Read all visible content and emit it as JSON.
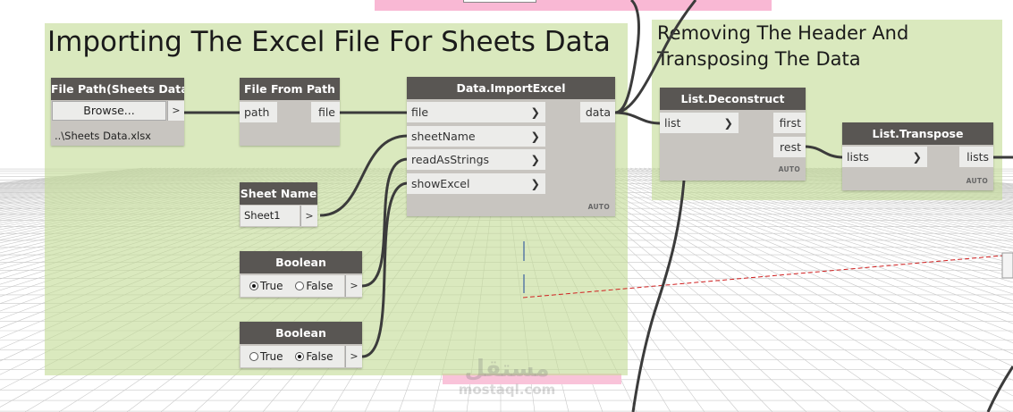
{
  "groups": {
    "import": {
      "title": "Importing The Excel File For Sheets Data"
    },
    "transpose": {
      "title_line1": "Removing The Header And",
      "title_line2": "Transposing The Data"
    }
  },
  "nodes": {
    "file_path": {
      "title": "File Path(Sheets Data)",
      "browse_label": "Browse...",
      "output_chevron": ">",
      "path_value": "..\\Sheets Data.xlsx"
    },
    "file_from_path": {
      "title": "File From Path",
      "input": "path",
      "output": "file"
    },
    "import_excel": {
      "title": "Data.ImportExcel",
      "inputs": [
        "file",
        "sheetName",
        "readAsStrings",
        "showExcel"
      ],
      "output": "data",
      "lacing": "AUTO"
    },
    "sheet_name": {
      "title": "Sheet Name",
      "value": "Sheet1",
      "output_chevron": ">"
    },
    "boolean_1": {
      "title": "Boolean",
      "true_label": "True",
      "false_label": "False",
      "selected": "True",
      "output_chevron": ">"
    },
    "boolean_2": {
      "title": "Boolean",
      "true_label": "True",
      "false_label": "False",
      "selected": "False",
      "output_chevron": ">"
    },
    "list_deconstruct": {
      "title": "List.Deconstruct",
      "input": "list",
      "outputs": [
        "first",
        "rest"
      ],
      "lacing": "AUTO"
    },
    "list_transpose": {
      "title": "List.Transpose",
      "input": "lists",
      "output": "lists",
      "lacing": "AUTO"
    }
  },
  "watermark": {
    "line1": "مستقل",
    "line2": "mostaql.com"
  },
  "colors": {
    "group_fill": "#c4dc96",
    "node_header": "#595653",
    "node_body": "#c8c5c0",
    "port_fill": "#ececea",
    "wire": "#3b3b3b",
    "pink_panel": "#f7b6d2",
    "dashed_line": "#d02020"
  }
}
